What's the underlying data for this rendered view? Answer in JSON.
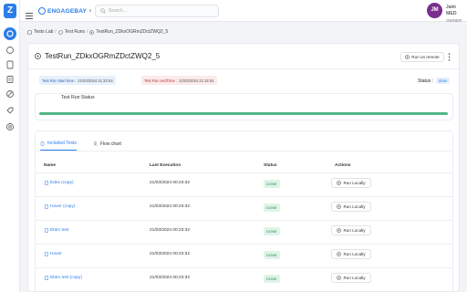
{
  "app": {
    "logo_letter": "Z",
    "brand_name": "ENGAGEBAY",
    "brand_caret": "∨"
  },
  "search": {
    "placeholder": "Search..."
  },
  "user": {
    "initials": "JM",
    "name": "Jaini MED",
    "role": "OWNER"
  },
  "breadcrumb": {
    "items": [
      "Tests Lab",
      "Test Runs",
      "TestRun_ZDkxOGRmZDctZWQ2_5"
    ],
    "separator": "/"
  },
  "header": {
    "title": "TestRun_ZDkxOGRmZDctZWQ2_5",
    "run_remote_label": "Run on remote"
  },
  "run_info": {
    "start_label": "Test Run start time :",
    "start_value": "21/03/2024 21:32:54",
    "end_label": "Test Run endTime :",
    "end_value": "22/03/2024 21:32:54",
    "status_label": "Status :",
    "status_value": "done"
  },
  "progress": {
    "label": "Test Run Status",
    "fraction": 1.0
  },
  "tabs": [
    {
      "label": "Included Tests",
      "active": true
    },
    {
      "label": "Flow chart",
      "active": false
    }
  ],
  "table": {
    "headers": [
      "Name",
      "Last Execution",
      "Status",
      "Actions"
    ],
    "rows": [
      {
        "name": "Edex (copy)",
        "last_execution": "21/03/2024 00:23:32",
        "status": "DONE",
        "action": "Run Locally"
      },
      {
        "name": "Hover (copy)",
        "last_execution": "21/03/2024 00:23:32",
        "status": "DONE",
        "action": "Run Locally"
      },
      {
        "name": "Ebtrx test",
        "last_execution": "21/03/2024 00:23:32",
        "status": "DONE",
        "action": "Run Locally"
      },
      {
        "name": "Hover",
        "last_execution": "21/03/2024 00:23:32",
        "status": "DONE",
        "action": "Run Locally"
      },
      {
        "name": "Ebtrx test (copy)",
        "last_execution": "21/03/2024 00:23:32",
        "status": "DONE",
        "action": "Run Locally"
      }
    ]
  },
  "colors": {
    "accent": "#2b7de9",
    "progress_fill": "#52b788",
    "done_badge_bg": "#def4e7",
    "avatar_bg": "#7b2f8e"
  },
  "icons": {
    "rail": [
      "home-icon",
      "document-icon",
      "list-icon",
      "block-icon",
      "tag-icon",
      "settings-icon"
    ]
  }
}
